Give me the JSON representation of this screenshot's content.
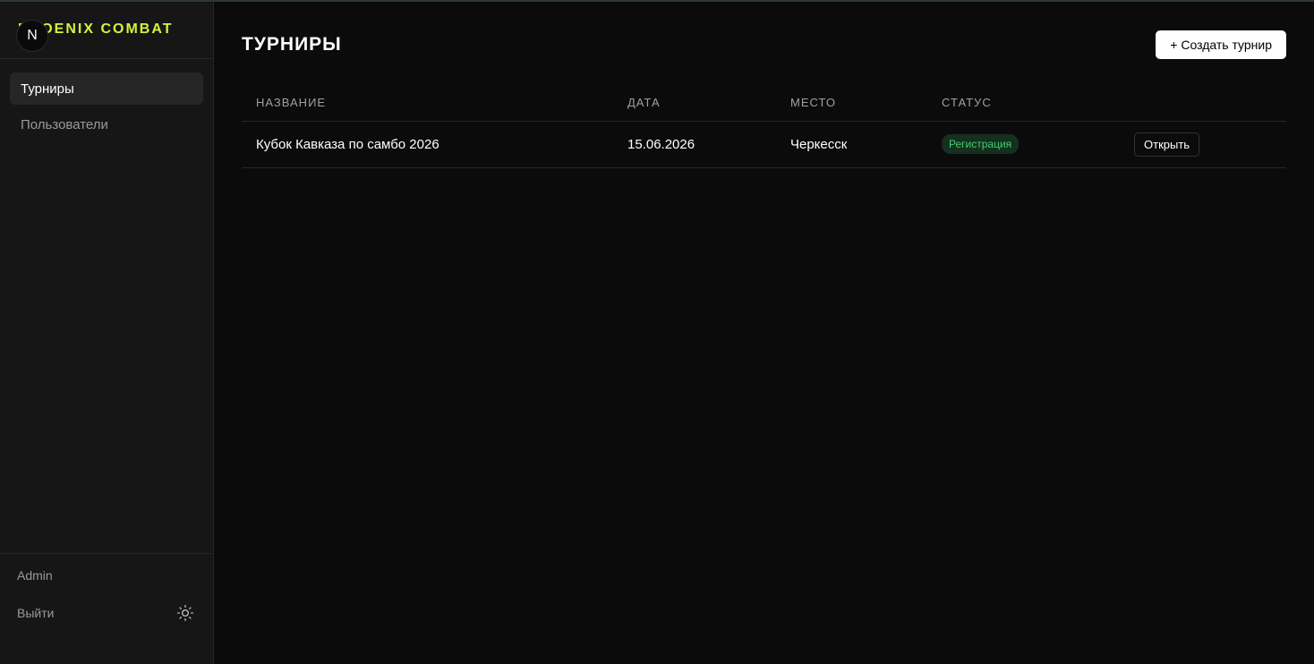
{
  "brand": {
    "name": "PHOENIX COMBAT",
    "logo_letter": "N",
    "accent": "#d6f23a"
  },
  "sidebar": {
    "items": [
      {
        "label": "Турниры",
        "active": true
      },
      {
        "label": "Пользователи",
        "active": false
      }
    ],
    "user": "Admin",
    "logout": "Выйти",
    "theme_icon": "sun-icon"
  },
  "main": {
    "title": "ТУРНИРЫ",
    "create_button": "+ Создать турнир",
    "table": {
      "headers": [
        "НАЗВАНИЕ",
        "ДАТА",
        "МЕСТО",
        "СТАТУС"
      ],
      "rows": [
        {
          "name": "Кубок Кавказа по самбо 2026",
          "date": "15.06.2026",
          "place": "Черкесск",
          "status": "Регистрация",
          "action": "Открыть"
        }
      ]
    }
  },
  "colors": {
    "background": "#0b0b0b",
    "sidebar": "#161616",
    "status_green": "#3fcf6e"
  }
}
